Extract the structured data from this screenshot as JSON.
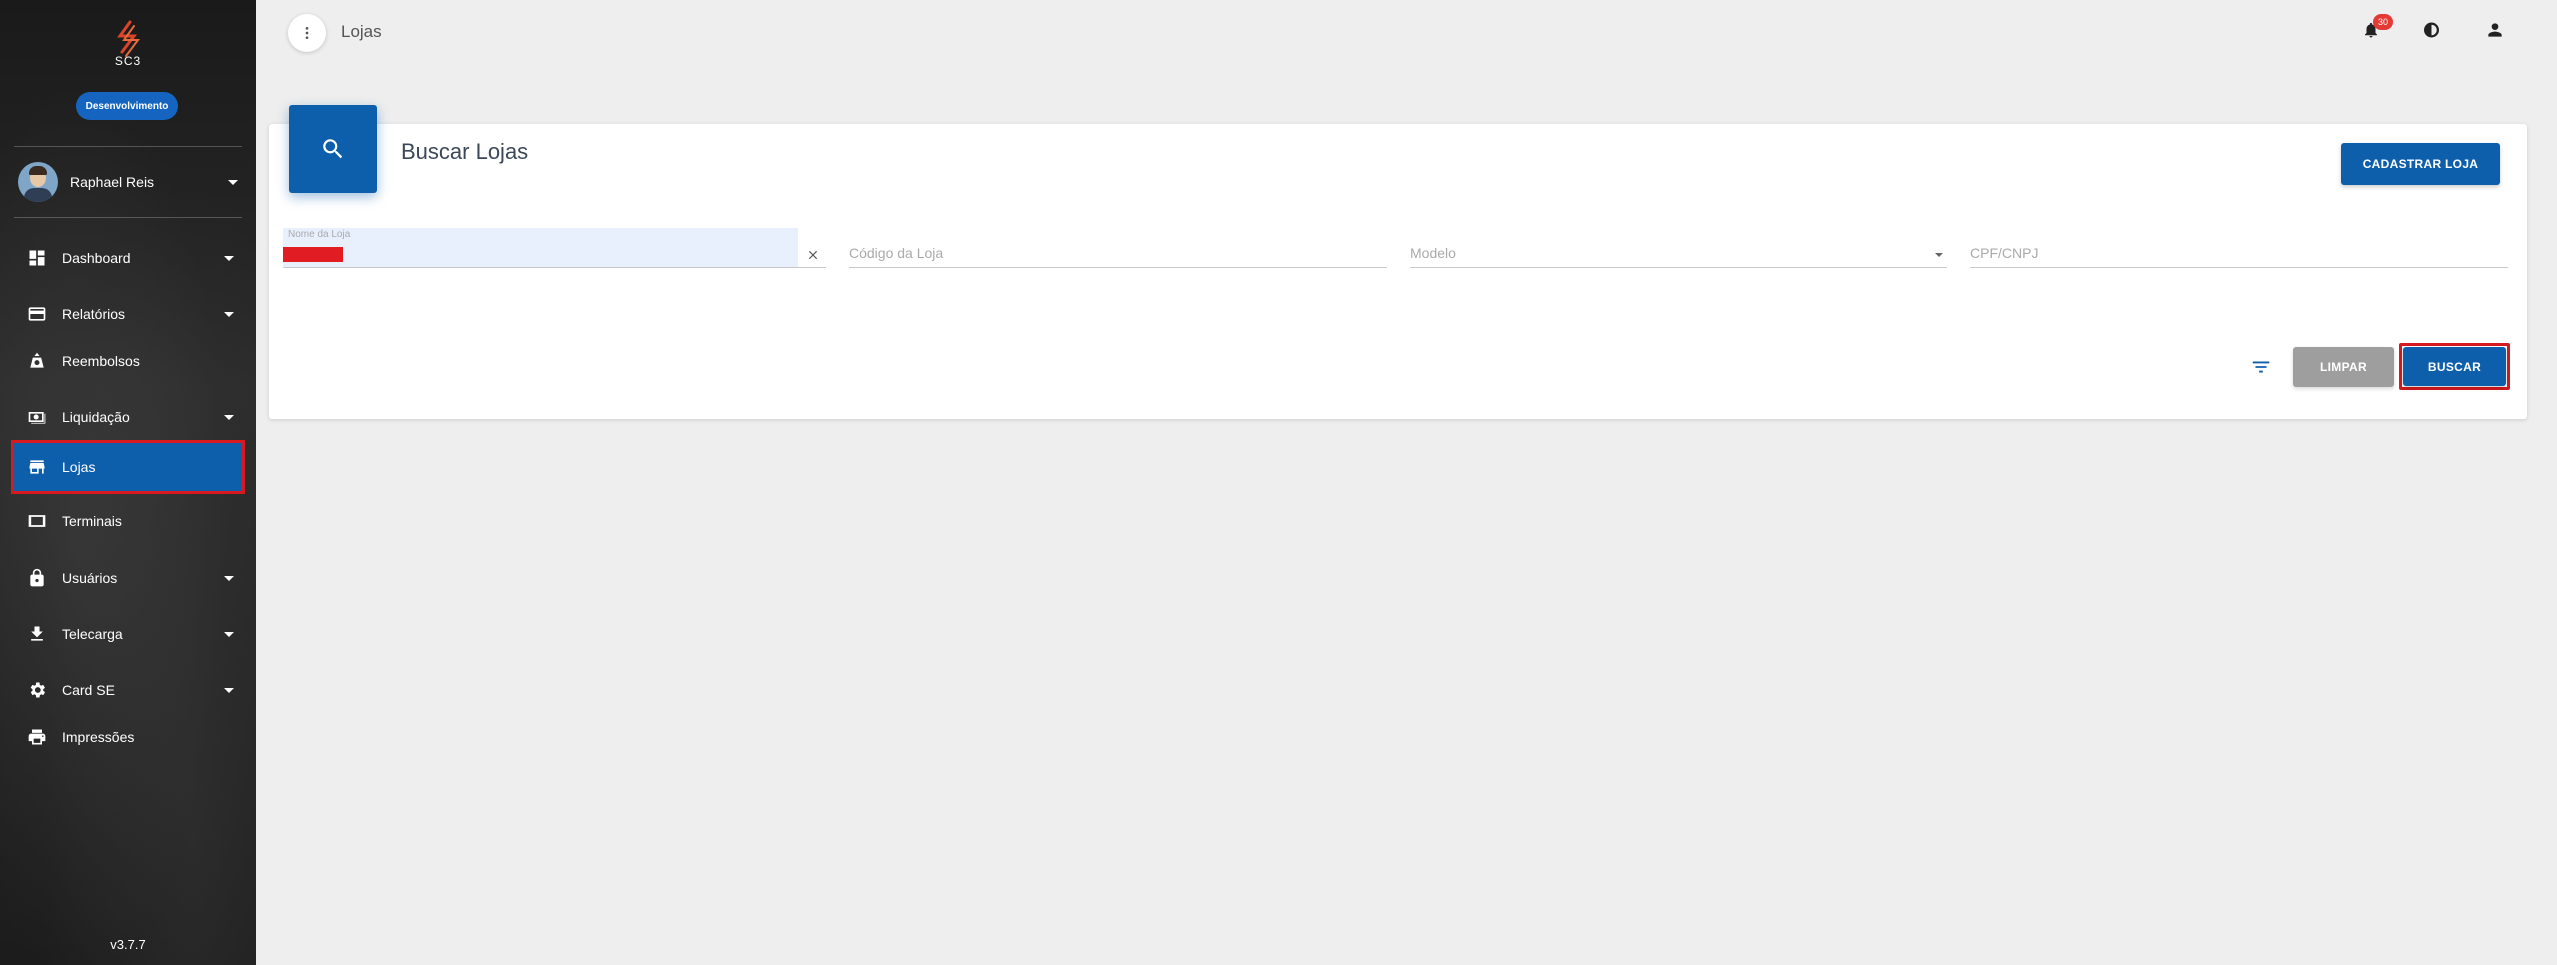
{
  "app": {
    "logo_text": "SC3",
    "environment": "Desenvolvimento",
    "version": "v3.7.7"
  },
  "user": {
    "name": "Raphael Reis"
  },
  "sidebar": {
    "items": [
      {
        "label": "Dashboard",
        "icon": "dashboard-icon",
        "has_caret": true
      },
      {
        "label": "Relatórios",
        "icon": "credit-card-icon",
        "has_caret": true
      },
      {
        "label": "Reembolsos",
        "icon": "money-bag-icon",
        "has_caret": false
      },
      {
        "label": "Liquidação",
        "icon": "cash-icon",
        "has_caret": true
      },
      {
        "label": "Lojas",
        "icon": "store-icon",
        "has_caret": false,
        "active": true
      },
      {
        "label": "Terminais",
        "icon": "terminal-icon",
        "has_caret": false
      },
      {
        "label": "Usuários",
        "icon": "lock-icon",
        "has_caret": true
      },
      {
        "label": "Telecarga",
        "icon": "download-icon",
        "has_caret": true
      },
      {
        "label": "Card SE",
        "icon": "gear-icon",
        "has_caret": true
      },
      {
        "label": "Impressões",
        "icon": "printer-icon",
        "has_caret": false
      }
    ]
  },
  "header": {
    "title": "Lojas",
    "notification_count": "30"
  },
  "search_card": {
    "title": "Buscar Lojas",
    "register_button": "CADASTRAR LOJA",
    "fields": {
      "store_name_label": "Nome da Loja",
      "store_code_placeholder": "Código da Loja",
      "model_placeholder": "Modelo",
      "cpf_cnpj_placeholder": "CPF/CNPJ"
    },
    "clear_button": "LIMPAR",
    "search_button": "BUSCAR"
  },
  "colors": {
    "primary": "#0d5fac",
    "highlight": "#d71920",
    "badge": "#e53935"
  }
}
